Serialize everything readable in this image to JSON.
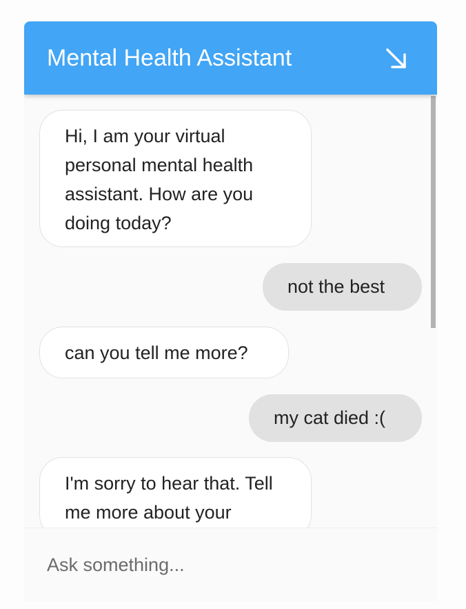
{
  "header": {
    "title": "Mental Health Assistant",
    "collapse_icon": "arrow-down-right-icon",
    "background": "#42a5f5"
  },
  "messages": [
    {
      "sender": "bot",
      "text": "Hi, I am your virtual personal mental health assistant. How are you doing today?"
    },
    {
      "sender": "user",
      "text": "not the best"
    },
    {
      "sender": "bot",
      "text": "can you tell me more?"
    },
    {
      "sender": "user",
      "text": "my cat died :("
    },
    {
      "sender": "bot",
      "text": "I'm sorry to hear that. Tell me more about your"
    }
  ],
  "input": {
    "placeholder": "Ask something...",
    "value": ""
  }
}
